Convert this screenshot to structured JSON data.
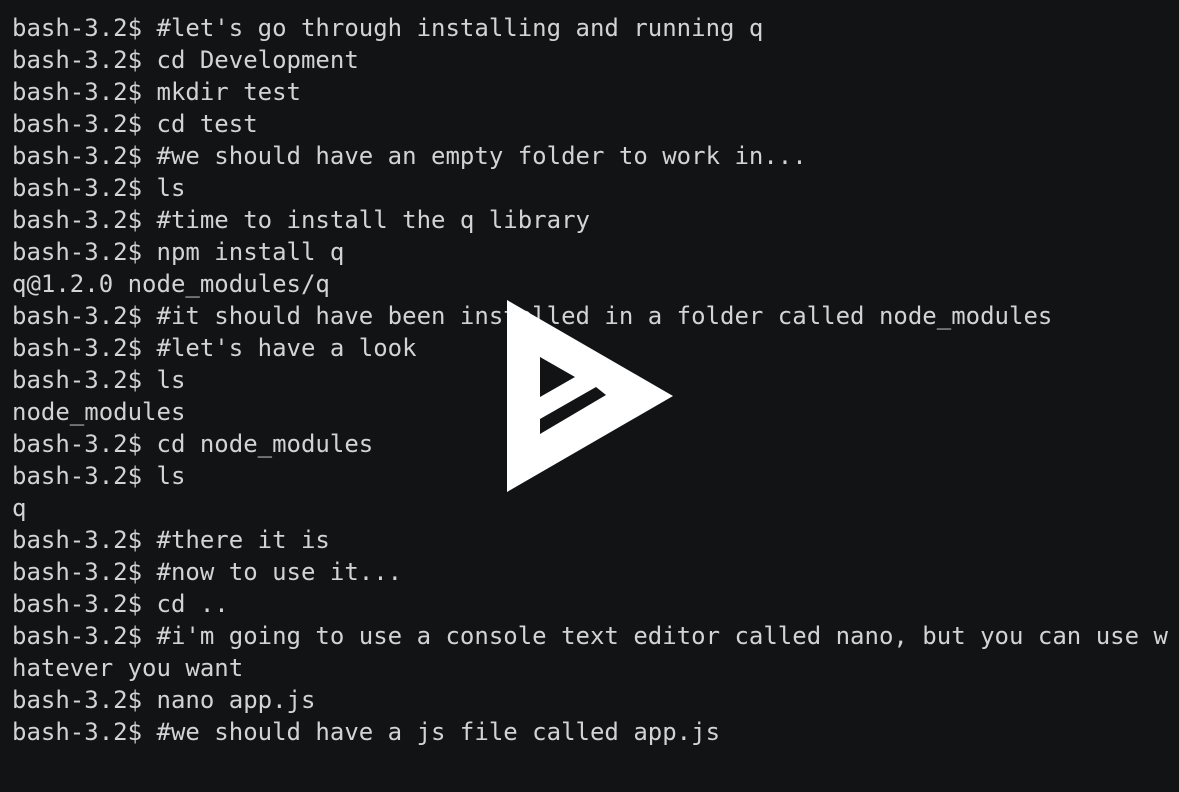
{
  "terminal": {
    "lines": [
      "bash-3.2$ #let's go through installing and running q",
      "bash-3.2$ cd Development",
      "bash-3.2$ mkdir test",
      "bash-3.2$ cd test",
      "bash-3.2$ #we should have an empty folder to work in...",
      "bash-3.2$ ls",
      "bash-3.2$ #time to install the q library",
      "bash-3.2$ npm install q",
      "q@1.2.0 node_modules/q",
      "bash-3.2$ #it should have been installed in a folder called node_modules",
      "bash-3.2$ #let's have a look",
      "bash-3.2$ ls",
      "node_modules",
      "bash-3.2$ cd node_modules",
      "bash-3.2$ ls",
      "q",
      "bash-3.2$ #there it is",
      "bash-3.2$ #now to use it...",
      "bash-3.2$ cd ..",
      "bash-3.2$ #i'm going to use a console text editor called nano, but you can use w",
      "hatever you want",
      "bash-3.2$ nano app.js",
      "bash-3.2$ #we should have a js file called app.js"
    ]
  },
  "overlay": {
    "icon": "asciinema-play-icon",
    "color": "#ffffff"
  },
  "colors": {
    "background": "#121314",
    "text": "#d2d3d4"
  }
}
